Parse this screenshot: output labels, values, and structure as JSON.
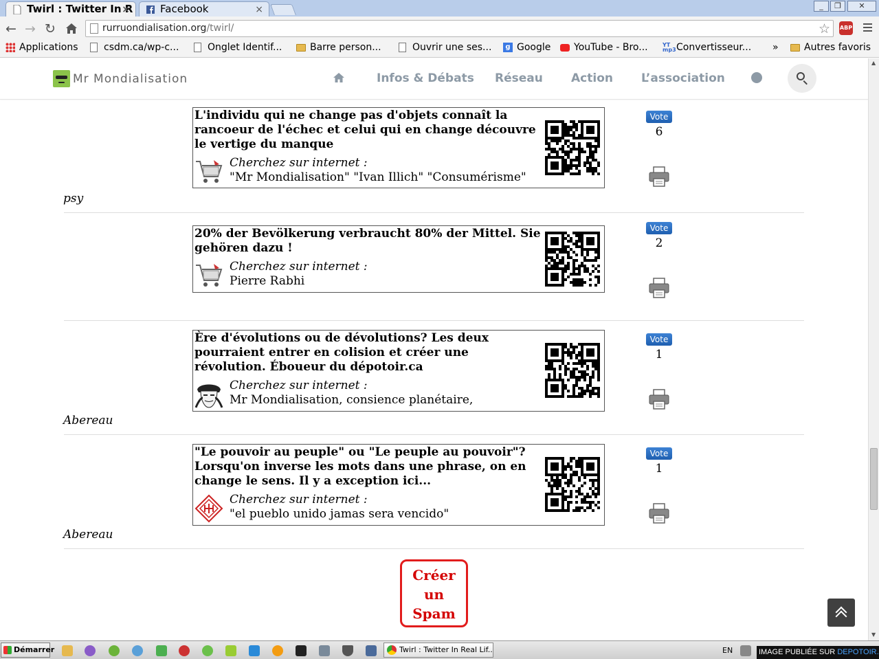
{
  "browser": {
    "tabs": [
      {
        "title": "Twirl : Twitter In R",
        "active": true
      },
      {
        "title": "Facebook",
        "active": false
      }
    ],
    "close_glyph": "×",
    "url_host": "rurruondialisation.org",
    "url_path": "/twirl/",
    "abp_label": "ABP",
    "bookmarks": [
      {
        "label": "Applications",
        "icon": "apps-icon"
      },
      {
        "label": "csdm.ca/wp-c...",
        "icon": "page-icon"
      },
      {
        "label": "Onglet Identif...",
        "icon": "page-icon"
      },
      {
        "label": "Barre person...",
        "icon": "folder-icon"
      },
      {
        "label": "Ouvrir une ses...",
        "icon": "page-icon"
      },
      {
        "label": "Google",
        "icon": "google-icon"
      },
      {
        "label": "YouTube - Bro...",
        "icon": "youtube-icon"
      },
      {
        "label": "Convertisseur...",
        "icon": "ytmp3-icon"
      }
    ],
    "bookmarks_more": "»",
    "other_bookmarks": "Autres favoris"
  },
  "site": {
    "logo_text": "Mr Mondialisation",
    "nav": [
      "Infos & Débats",
      "Réseau",
      "Action",
      "L’association"
    ]
  },
  "twirls": [
    {
      "text": "L'individu qui ne change pas d'objets connaît la rancoeur de l'échec et celui qui en change découvre le vertige du manque",
      "search_label": "Cherchez sur internet :",
      "search_terms": "\"Mr Mondialisation\" \"Ivan Illich\" \"Consumérisme\"",
      "thumb": "shopping-cart-icon",
      "vote_label": "Vote",
      "votes": "6",
      "author": "psy"
    },
    {
      "text": "20% der Bevölkerung verbraucht 80% der Mittel. Sie gehören dazu !",
      "search_label": "Cherchez sur internet :",
      "search_terms": "Pierre Rabhi",
      "thumb": "shopping-cart-icon",
      "vote_label": "Vote",
      "votes": "2",
      "author": ""
    },
    {
      "text": "Ère d'évolutions ou de dévolutions? Les deux pourraient entrer en colision et créer une révolution. Éboueur du dépotoir.ca",
      "search_label": "Cherchez sur internet :",
      "search_terms": "Mr Mondialisation, consience planétaire,",
      "thumb": "anonymous-mask-icon",
      "vote_label": "Vote",
      "votes": "1",
      "author": "Abereau"
    },
    {
      "text": "\"Le pouvoir au peuple\" ou \"Le peuple au pouvoir\"? Lorsqu'on inverse les mots dans une phrase, on en change le sens. Il y a exception ici...",
      "search_label": "Cherchez sur internet :",
      "search_terms": "\"el pueblo unido jamas sera vencido\"",
      "thumb": "red-emblem-icon",
      "vote_label": "Vote",
      "votes": "1",
      "author": "Abereau"
    }
  ],
  "create_spam": {
    "line1": "Créer",
    "line2": "un",
    "line3": "Spam"
  },
  "taskbar": {
    "start_label": "Démarrer",
    "active_window": "Twirl : Twitter In Real Lif...",
    "language": "EN"
  },
  "watermark": {
    "prefix": "IMAGE PUBLIÉE SUR ",
    "brand": "DEPOTOIR.CA"
  },
  "colors": {
    "accent_green": "#8bc34a",
    "nav_gray": "#8d9aa6",
    "vote_blue": "#2a6fc2",
    "spam_red": "#e21c1c"
  }
}
